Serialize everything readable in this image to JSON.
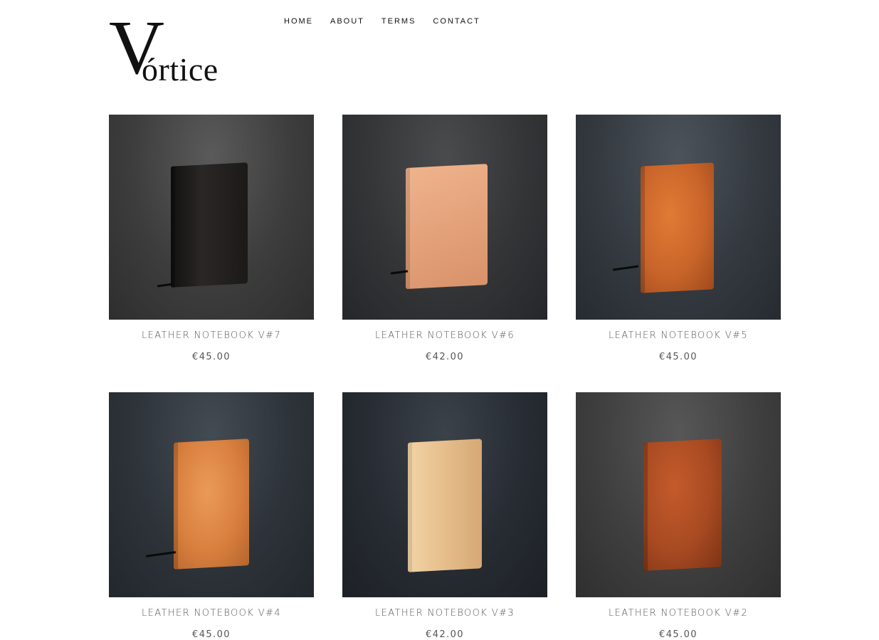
{
  "brand": {
    "logo_initial": "V",
    "logo_rest": "órtice"
  },
  "nav": {
    "items": [
      "HOME",
      "ABOUT",
      "TERMS",
      "CONTACT"
    ]
  },
  "products": [
    {
      "title": "LEATHER NOTEBOOK V#7",
      "price": "€45.00",
      "cover_color": "#1c1a19",
      "bg": "#3d3d3d"
    },
    {
      "title": "LEATHER NOTEBOOK V#6",
      "price": "€42.00",
      "cover_color": "#e4a27b",
      "bg": "#343537"
    },
    {
      "title": "LEATHER NOTEBOOK V#5",
      "price": "€45.00",
      "cover_color": "#c9652a",
      "bg": "#343a40"
    },
    {
      "title": "LEATHER NOTEBOOK V#4",
      "price": "€45.00",
      "cover_color": "#d9803f",
      "bg": "#2d3339"
    },
    {
      "title": "LEATHER NOTEBOOK V#3",
      "price": "€42.00",
      "cover_color": "#e7c08e",
      "bg": "#272c33"
    },
    {
      "title": "LEATHER NOTEBOOK V#2",
      "price": "€45.00",
      "cover_color": "#a84a22",
      "bg": "#3f3f3f"
    }
  ]
}
